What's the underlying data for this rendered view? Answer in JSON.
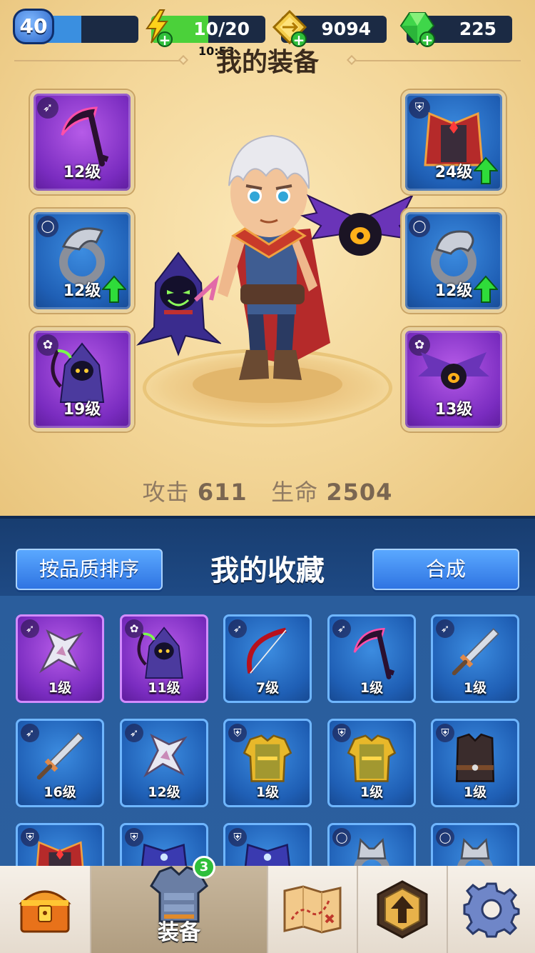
{
  "status": {
    "level": "40",
    "xp_fraction": 0.4,
    "energy": "10/20",
    "energy_fraction": 0.5,
    "gold": "9094",
    "gems": "225",
    "time": "10:53"
  },
  "equip": {
    "title": "我的装备",
    "slots": [
      {
        "type_icon": "weapon-icon",
        "level": "12级",
        "rarity": "purple",
        "item": "scythe",
        "upgrade": false
      },
      {
        "type_icon": "ring-icon",
        "level": "12级",
        "rarity": "blue",
        "item": "eagle-ring",
        "upgrade": true
      },
      {
        "type_icon": "pet-icon",
        "level": "19级",
        "rarity": "purple",
        "item": "reaper-pet",
        "upgrade": false
      },
      {
        "type_icon": "armor-icon",
        "level": "24级",
        "rarity": "blue",
        "item": "red-cape",
        "upgrade": true
      },
      {
        "type_icon": "ring-icon",
        "level": "12级",
        "rarity": "blue",
        "item": "snake-ring",
        "upgrade": true
      },
      {
        "type_icon": "pet-icon",
        "level": "13级",
        "rarity": "purple",
        "item": "bat-pet",
        "upgrade": false
      }
    ],
    "stats": {
      "attack_label": "攻击",
      "attack_value": "611",
      "hp_label": "生命",
      "hp_value": "2504"
    }
  },
  "collection": {
    "sort_button": "按品质排序",
    "title": "我的收藏",
    "merge_button": "合成",
    "items": [
      {
        "type_icon": "weapon-icon",
        "level": "1级",
        "rarity": "purple",
        "item": "shuriken"
      },
      {
        "type_icon": "pet-icon",
        "level": "11级",
        "rarity": "purple",
        "item": "reaper-pet"
      },
      {
        "type_icon": "weapon-icon",
        "level": "7级",
        "rarity": "blue",
        "item": "bow"
      },
      {
        "type_icon": "weapon-icon",
        "level": "1级",
        "rarity": "blue",
        "item": "scythe"
      },
      {
        "type_icon": "weapon-icon",
        "level": "1级",
        "rarity": "blue",
        "item": "sword"
      },
      {
        "type_icon": "weapon-icon",
        "level": "16级",
        "rarity": "blue",
        "item": "sword"
      },
      {
        "type_icon": "weapon-icon",
        "level": "12级",
        "rarity": "blue",
        "item": "shuriken"
      },
      {
        "type_icon": "armor-icon",
        "level": "1级",
        "rarity": "blue",
        "item": "gold-armor"
      },
      {
        "type_icon": "armor-icon",
        "level": "1级",
        "rarity": "blue",
        "item": "gold-armor"
      },
      {
        "type_icon": "armor-icon",
        "level": "1级",
        "rarity": "blue",
        "item": "dark-vest"
      },
      {
        "type_icon": "armor-icon",
        "level": "",
        "rarity": "blue",
        "item": "red-cape"
      },
      {
        "type_icon": "armor-icon",
        "level": "",
        "rarity": "blue",
        "item": "blue-robe"
      },
      {
        "type_icon": "armor-icon",
        "level": "",
        "rarity": "blue",
        "item": "blue-robe"
      },
      {
        "type_icon": "ring-icon",
        "level": "",
        "rarity": "blue",
        "item": "wolf-ring"
      },
      {
        "type_icon": "ring-icon",
        "level": "",
        "rarity": "blue",
        "item": "wolf-ring"
      }
    ]
  },
  "nav": {
    "tabs": [
      {
        "name": "shop",
        "icon": "treasure-chest-icon",
        "label": ""
      },
      {
        "name": "equipment",
        "icon": "armor-icon",
        "label": "装备",
        "badge": "3",
        "active": true
      },
      {
        "name": "map",
        "icon": "map-icon",
        "label": ""
      },
      {
        "name": "upgrade",
        "icon": "upgrade-icon",
        "label": ""
      },
      {
        "name": "settings",
        "icon": "gear-icon",
        "label": ""
      }
    ]
  },
  "colors": {
    "purple_rarity": "#7a2cc0",
    "blue_rarity": "#1f5fb5",
    "accent_green": "#2fbf3a",
    "panel_bg": "#f3d698"
  }
}
